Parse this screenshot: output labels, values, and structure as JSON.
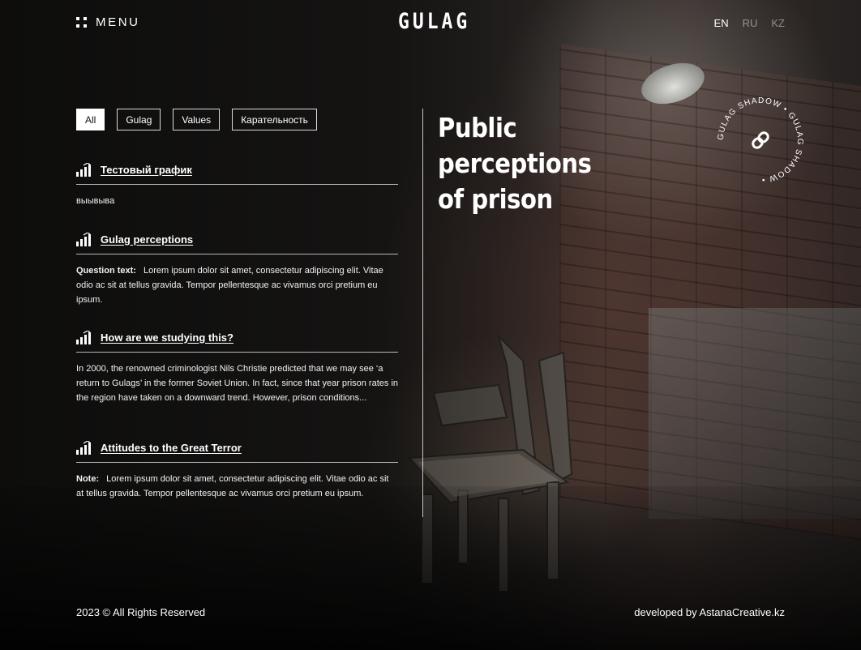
{
  "header": {
    "menu_label": "MENU",
    "logo": "GULAG",
    "languages": [
      {
        "code": "EN",
        "active": true
      },
      {
        "code": "RU",
        "active": false
      },
      {
        "code": "KZ",
        "active": false
      }
    ]
  },
  "filters": [
    {
      "label": "All",
      "active": true
    },
    {
      "label": "Gulag",
      "active": false
    },
    {
      "label": "Values",
      "active": false
    },
    {
      "label": "Карательность",
      "active": false
    }
  ],
  "items": [
    {
      "icon": "bar-chart-icon",
      "title": "Тестовый график",
      "prefix": "",
      "text": "выывыва"
    },
    {
      "icon": "bar-chart-icon",
      "title": "Gulag perceptions",
      "prefix": "Question text:",
      "text": "Lorem ipsum dolor sit amet, consectetur adipiscing elit. Vitae odio ac sit at tellus gravida. Tempor pellentesque ac vivamus orci pretium eu ipsum."
    },
    {
      "icon": "bar-chart-icon",
      "title": "How are we studying this?",
      "prefix": "",
      "text": "In 2000, the renowned criminologist Nils Christie predicted that we may see ‘a return to Gulags’ in the former Soviet Union. In fact, since that year prison rates in the region have taken on a downward trend. However, prison conditions..."
    },
    {
      "icon": "bar-chart-icon",
      "title": "Attitudes to the Great Terror",
      "prefix": "Note:",
      "text": "Lorem ipsum dolor sit amet, consectetur adipiscing elit. Vitae odio ac sit at tellus gravida. Tempor pellentesque ac vivamus orci pretium eu ipsum."
    }
  ],
  "hero": {
    "title_line1": "Public perceptions",
    "title_line2": "of prison"
  },
  "badge": {
    "circular_text": "GULAG SHADOW • GULAG SHADOW • ",
    "icon": "link-icon"
  },
  "footer": {
    "copyright": "2023 © All Rights Reserved",
    "credit": "developed by AstanaCreative.kz"
  },
  "colors": {
    "text": "#ffffff",
    "active_filter_bg": "#ffffff",
    "active_filter_text": "#111111"
  }
}
